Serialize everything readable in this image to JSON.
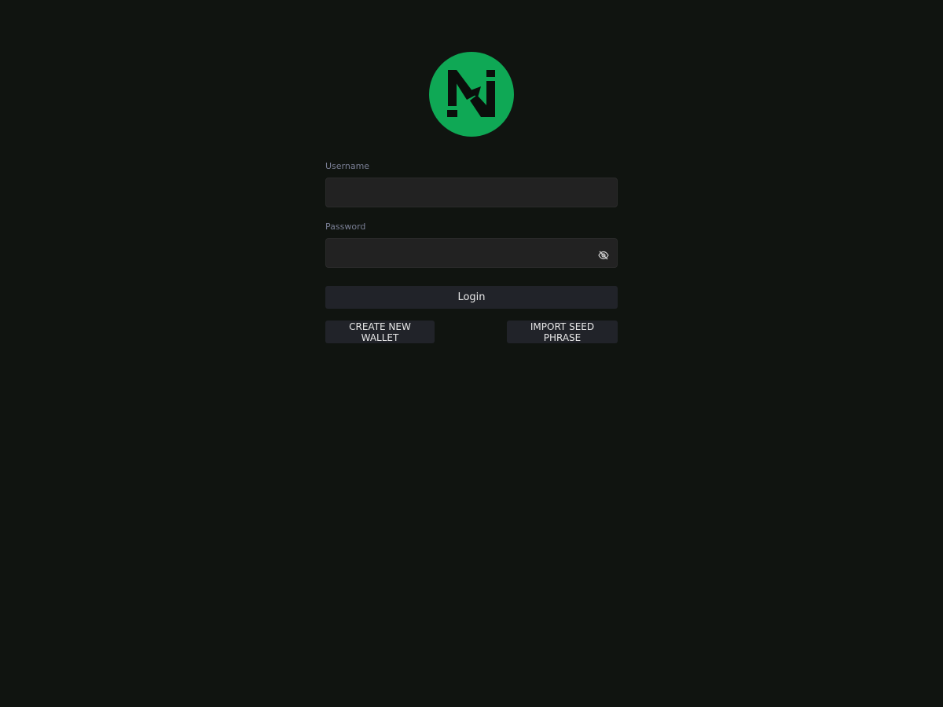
{
  "app": {
    "logo_icon": "n-lettermark-logo",
    "logo_color": "#0fa855",
    "background_color": "#101410"
  },
  "login_form": {
    "username_label": "Username",
    "username_value": "",
    "password_label": "Password",
    "password_value": "",
    "password_toggle_icon": "eye-slash-icon",
    "login_label": "Login"
  },
  "actions": {
    "create_wallet_label": "CREATE NEW WALLET",
    "import_seed_label": "IMPORT SEED PHRASE"
  }
}
